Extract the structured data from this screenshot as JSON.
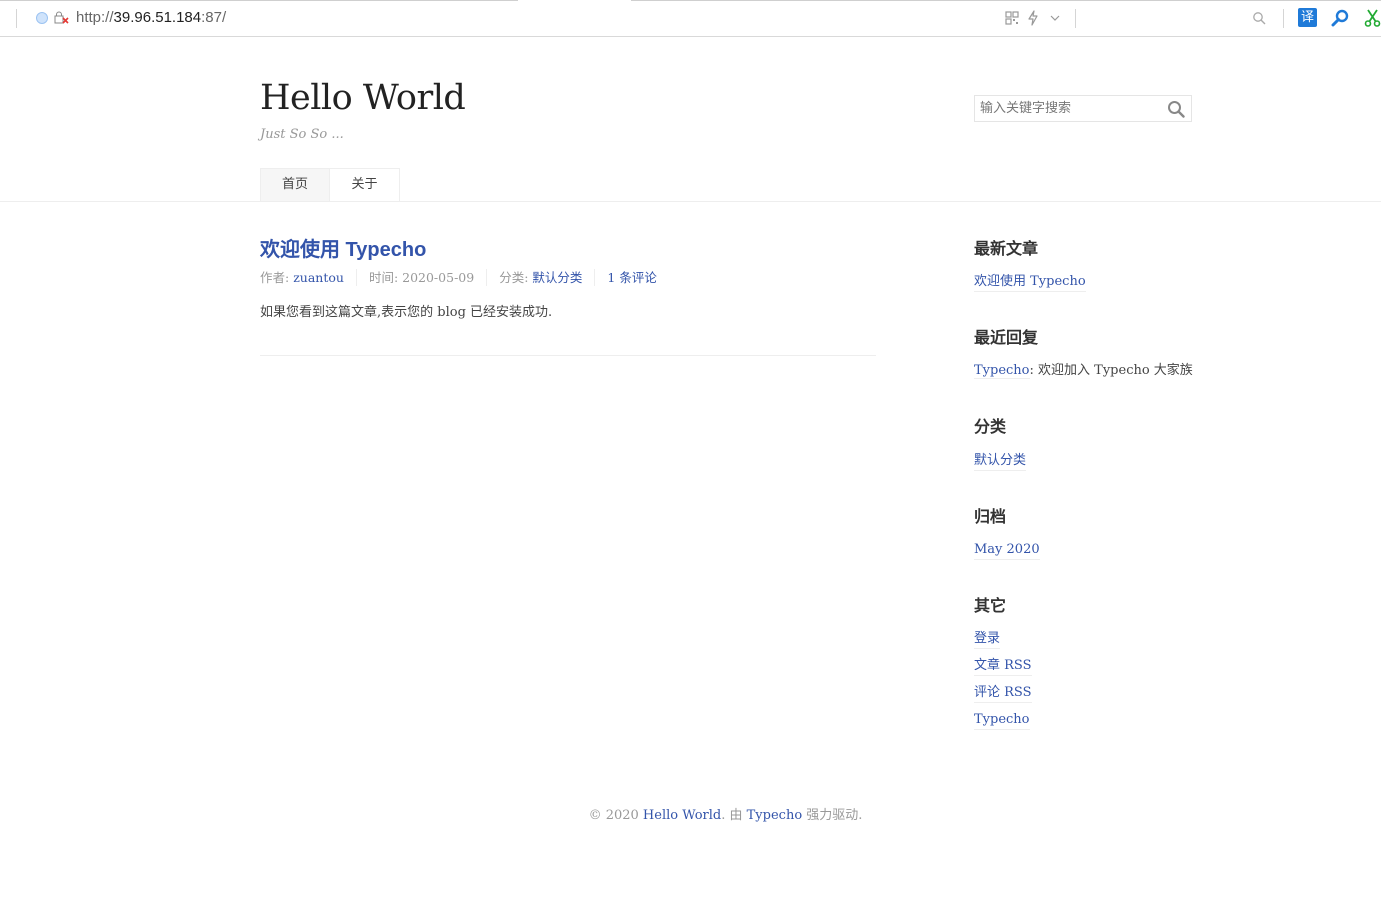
{
  "browser": {
    "url_scheme": "http://",
    "url_host": "39.96.51.184",
    "url_rest": ":87/",
    "translate_label": "译",
    "icons": [
      "globe-icon",
      "insecure-lock-icon",
      "qr-code-icon",
      "lightning-icon",
      "chevron-down-icon",
      "search-icon",
      "translate-icon",
      "magnifier-icon",
      "scissors-icon"
    ],
    "colors": {
      "translate_bg": "#1f7ad8",
      "magnifier": "#1f7ad8",
      "scissors": "#22aa33",
      "lock_x": "#e53935"
    }
  },
  "header": {
    "title": "Hello World",
    "description": "Just So So ...",
    "search_placeholder": "输入关键字搜索"
  },
  "nav": {
    "items": [
      {
        "label": "首页",
        "current": true
      },
      {
        "label": "关于",
        "current": false
      }
    ]
  },
  "post": {
    "title": "欢迎使用 Typecho",
    "meta": {
      "author_label": "作者: ",
      "author": "zuantou",
      "time_label": "时间: ",
      "time": "2020-05-09",
      "category_label": "分类: ",
      "category": "默认分类",
      "comments": "1 条评论"
    },
    "content": "如果您看到这篇文章,表示您的 blog 已经安装成功."
  },
  "sidebar": {
    "recent_posts": {
      "title": "最新文章",
      "items": [
        "欢迎使用 Typecho"
      ]
    },
    "recent_comments": {
      "title": "最近回复",
      "author": "Typecho",
      "text": ": 欢迎加入 Typecho 大家族"
    },
    "categories": {
      "title": "分类",
      "items": [
        "默认分类"
      ]
    },
    "archives": {
      "title": "归档",
      "items": [
        "May 2020"
      ]
    },
    "other": {
      "title": "其它",
      "items": [
        "登录",
        "文章 RSS",
        "评论 RSS",
        "Typecho"
      ]
    }
  },
  "footer": {
    "prefix": "© 2020 ",
    "site": "Hello World",
    "middle": ". 由 ",
    "powered": "Typecho",
    "suffix": " 强力驱动."
  },
  "colors": {
    "link": "#3354aa",
    "muted": "#999999",
    "text": "#444444"
  }
}
